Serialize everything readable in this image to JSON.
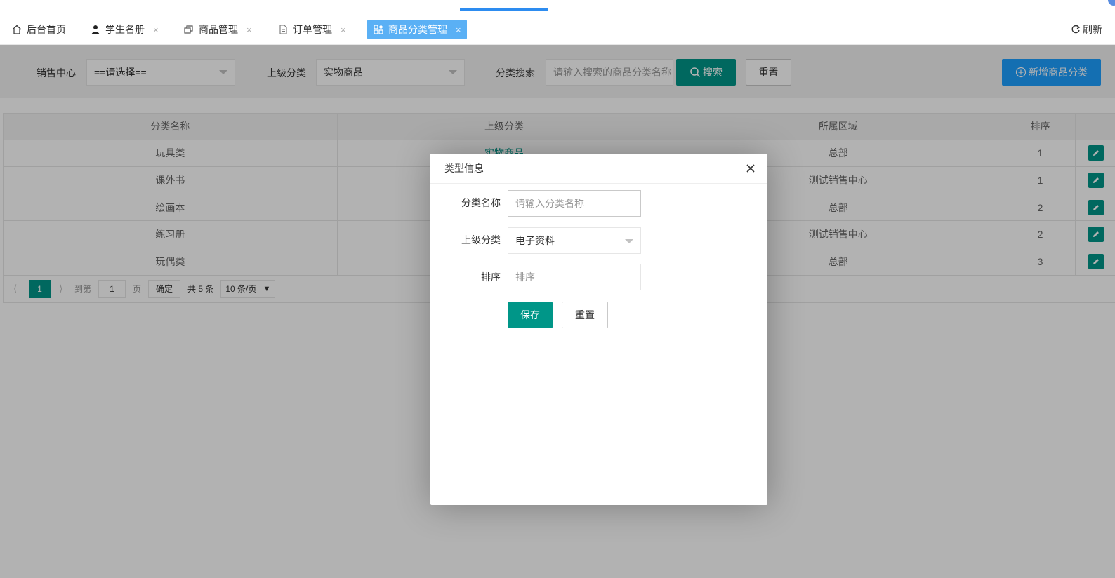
{
  "tabs": [
    {
      "label": "后台首页",
      "icon": "home-icon"
    },
    {
      "label": "学生名册",
      "icon": "user-icon"
    },
    {
      "label": "商品管理",
      "icon": "goods-icon"
    },
    {
      "label": "订单管理",
      "icon": "document-icon"
    },
    {
      "label": "商品分类管理",
      "icon": "category-icon",
      "active": true
    }
  ],
  "tab_close": "×",
  "refresh_label": "刷新",
  "filters": {
    "sales_center_label": "销售中心",
    "sales_center_value": "==请选择==",
    "parent_label": "上级分类",
    "parent_value": "实物商品",
    "search_label": "分类搜索",
    "search_placeholder": "请输入搜索的商品分类名称",
    "search_button": "搜索",
    "reset_button": "重置",
    "add_button": "新增商品分类"
  },
  "table": {
    "headers": [
      "分类名称",
      "上级分类",
      "所属区域",
      "排序"
    ],
    "rows": [
      {
        "name": "玩具类",
        "parent": "实物商品",
        "region": "总部",
        "order": "1"
      },
      {
        "name": "课外书",
        "parent": "",
        "region": "测试销售中心",
        "order": "1"
      },
      {
        "name": "绘画本",
        "parent": "",
        "region": "总部",
        "order": "2"
      },
      {
        "name": "练习册",
        "parent": "",
        "region": "测试销售中心",
        "order": "2"
      },
      {
        "name": "玩偶类",
        "parent": "",
        "region": "总部",
        "order": "3"
      }
    ]
  },
  "pager": {
    "current": "1",
    "goto_label": "到第",
    "goto_value": "1",
    "page_unit": "页",
    "confirm": "确定",
    "total": "共 5 条",
    "page_size": "10 条/页"
  },
  "modal": {
    "title": "类型信息",
    "name_label": "分类名称",
    "name_placeholder": "请输入分类名称",
    "parent_label": "上级分类",
    "parent_value": "电子资料",
    "order_label": "排序",
    "order_placeholder": "排序",
    "save_button": "保存",
    "reset_button": "重置"
  },
  "colors": {
    "primary_green": "#009688",
    "primary_blue": "#1e9fff",
    "active_tab": "#5ab0f5"
  }
}
